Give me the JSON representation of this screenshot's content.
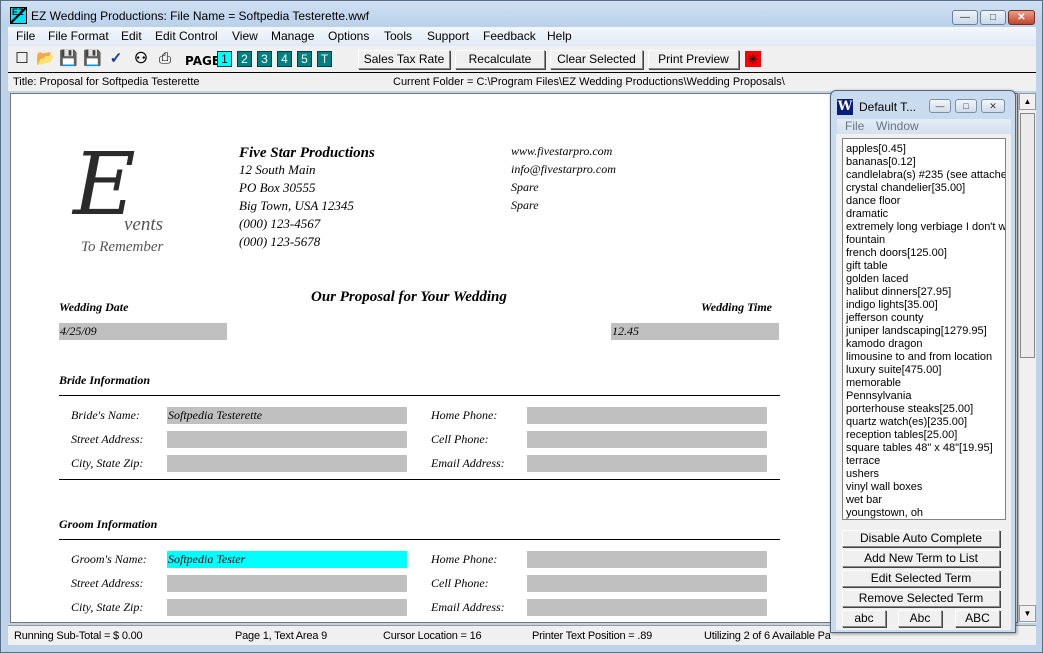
{
  "window": {
    "title": "EZ Wedding Productions: File Name = Softpedia Testerette.wwf",
    "minimize_glyph": "—",
    "maximize_glyph": "□",
    "close_glyph": "✕",
    "app_icon_text": "EZ"
  },
  "menu": [
    "File",
    "File Format",
    "Edit",
    "Edit Control",
    "View",
    "Manage",
    "Options",
    "Tools",
    "Support",
    "Feedback",
    "Help"
  ],
  "toolbar": {
    "icons": [
      {
        "name": "new-document-icon",
        "glyph": "☐"
      },
      {
        "name": "open-folder-icon",
        "glyph": "📂"
      },
      {
        "name": "save-icon",
        "glyph": "💾"
      },
      {
        "name": "save-as-icon",
        "glyph": "💾"
      },
      {
        "name": "spellcheck-icon",
        "glyph": "✓"
      },
      {
        "name": "find-binoculars-icon",
        "glyph": "⚇"
      },
      {
        "name": "print-icon",
        "glyph": "⎙"
      }
    ],
    "page_label": "PAGE",
    "pages": [
      "1",
      "2",
      "3",
      "4",
      "5",
      "T"
    ],
    "active_page": "1",
    "buttons": {
      "sales_tax": "Sales Tax Rate",
      "recalculate": "Recalculate",
      "clear_selected": "Clear Selected",
      "print_preview": "Print Preview"
    },
    "star_glyph": "✳"
  },
  "infobar": {
    "title": "Title: Proposal for Softpedia Testerette",
    "folder": "Current Folder = C:\\Program Files\\EZ Wedding Productions\\Wedding Proposals\\"
  },
  "document": {
    "logo": {
      "big": "E",
      "rest": "vents",
      "sub": "To Remember"
    },
    "company": {
      "name": "Five Star Productions",
      "lines": [
        "12 South Main",
        "PO Box 30555",
        "Big Town, USA 12345",
        "(000) 123-4567",
        "(000) 123-5678"
      ],
      "right_lines": [
        "www.fivestarpro.com",
        "info@fivestarpro.com",
        "Spare",
        "Spare"
      ]
    },
    "heading": "Our Proposal for Your Wedding",
    "wedding_date_label": "Wedding Date",
    "wedding_date": "4/25/09",
    "wedding_time_label": "Wedding Time",
    "wedding_time": "12.45",
    "bride": {
      "section_label": "Bride Information",
      "name_label": "Bride's Name:",
      "name": "Softpedia Testerette",
      "street_label": "Street Address:",
      "street": "",
      "city_label": "City, State Zip:",
      "city": "",
      "home_label": "Home Phone:",
      "home": "",
      "cell_label": "Cell Phone:",
      "cell": "",
      "email_label": "Email Address:",
      "email": ""
    },
    "groom": {
      "section_label": "Groom Information",
      "name_label": "Groom's Name:",
      "name": "Softpedia Tester",
      "street_label": "Street Address:",
      "street": "",
      "city_label": "City, State Zip:",
      "city": "",
      "home_label": "Home Phone:",
      "home": "",
      "cell_label": "Cell Phone:",
      "cell": "",
      "email_label": "Email Address:",
      "email": ""
    }
  },
  "statusbar": {
    "subtotal": "Running Sub-Total = $ 0.00",
    "page": "Page 1, Text Area 9",
    "cursor": "Cursor Location = 16",
    "printer": "Printer Text Position = .89",
    "utilizing": "Utilizing 2 of 6 Available Pa"
  },
  "palette": {
    "title": "Default T...",
    "icon_text": "W",
    "menu": [
      "File",
      "Window"
    ],
    "terms": [
      "apples[0.45]",
      "bananas[0.12]",
      "candlelabra(s) #235 (see attache",
      "crystal chandelier[35.00]",
      "dance floor",
      "dramatic",
      "extremely long verbiage I don't w",
      "fountain",
      "french doors[125.00]",
      "gift table",
      "golden laced",
      "halibut dinners[27.95]",
      "indigo lights[35.00]",
      "jefferson county",
      "juniper landscaping[1279.95]",
      "kamodo dragon",
      "limousine to and from location",
      "luxury suite[475.00]",
      "memorable",
      "Pennsylvania",
      "porterhouse steaks[25.00]",
      "quartz watch(es)[235.00]",
      "reception tables[25.00]",
      "square tables 48\" x 48\"[19.95]",
      "terrace",
      "ushers",
      "vinyl wall boxes",
      "wet bar",
      "youngstown, oh"
    ],
    "buttons": {
      "disable_auto": "Disable Auto Complete",
      "add_term": "Add New Term to List",
      "edit_term": "Edit Selected Term",
      "remove_term": "Remove Selected Term",
      "lower": "abc",
      "title_case": "Abc",
      "upper": "ABC"
    }
  },
  "colors": {
    "page_button": "#008080",
    "page_button_active": "#00ffff",
    "field_bg": "#c0c0c0",
    "field_highlight": "#00ffff",
    "star_button": "#ff0000"
  }
}
